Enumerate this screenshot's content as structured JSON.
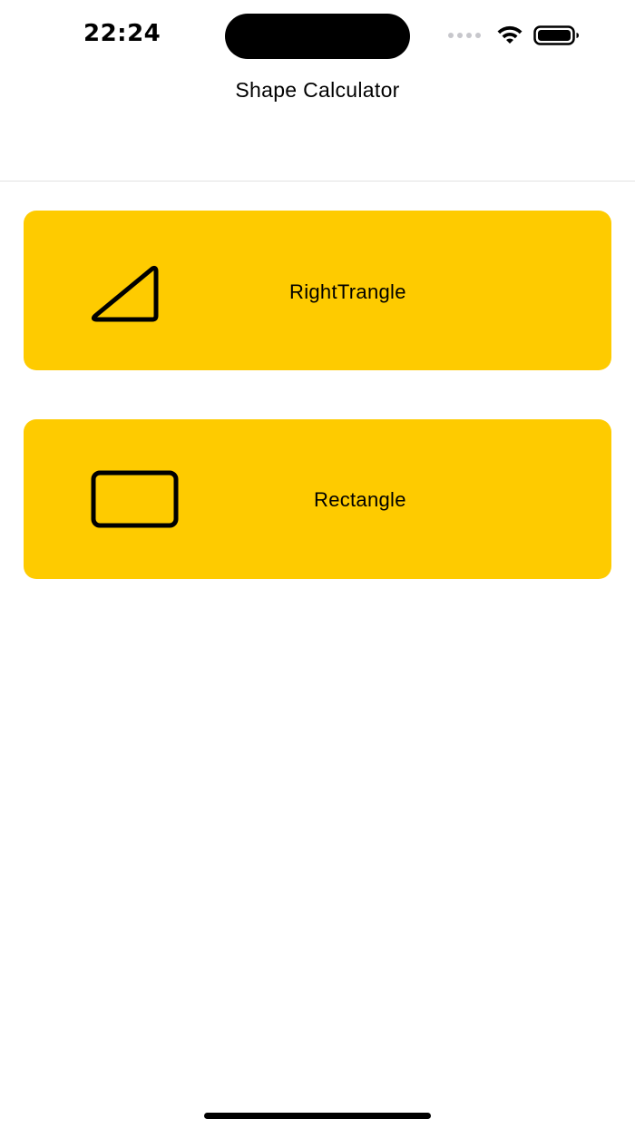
{
  "status_bar": {
    "time": "22:24",
    "icons": [
      "signal-dots-icon",
      "wifi-icon",
      "battery-icon"
    ]
  },
  "nav": {
    "title": "Shape Calculator"
  },
  "shapes": [
    {
      "label": "RightTrangle",
      "icon": "right-triangle-icon"
    },
    {
      "label": "Rectangle",
      "icon": "rectangle-icon"
    }
  ],
  "colors": {
    "card_background": "#FECB00",
    "page_background": "#FFFFFF",
    "text": "#000000",
    "divider": "#E2E2E2"
  }
}
